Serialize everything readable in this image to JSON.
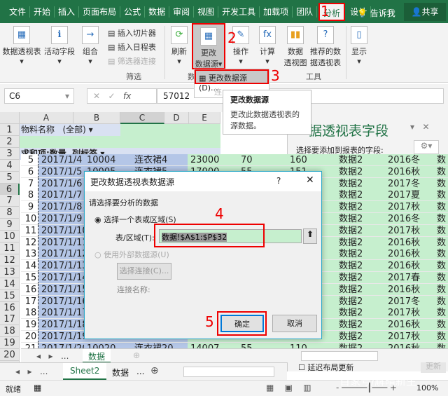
{
  "ribbon_tabs": [
    "文件",
    "开始",
    "插入",
    "页面布局",
    "公式",
    "数据",
    "审阅",
    "视图",
    "开发工具",
    "加载项",
    "团队",
    "分析",
    "设计"
  ],
  "active_tab": "分析",
  "tell_me": "告诉我",
  "share": "共享",
  "ribbon": {
    "pivot_table": "数据透视表",
    "active_field": "活动字段",
    "group": "组合",
    "insert_slicer": "插入切片器",
    "insert_timeline": "插入日程表",
    "filter_connections": "筛选器连接",
    "filter_group": "筛选",
    "refresh": "刷新",
    "change_source_1": "更改",
    "change_source_2": "数据源",
    "actions": "操作",
    "calculate": "计算",
    "pivot_chart_1": "数据",
    "pivot_chart_2": "透视图",
    "recommended_1": "推荐的数",
    "recommended_2": "据透视表",
    "tools_group": "工具",
    "show": "显示",
    "data_group": "数"
  },
  "dropdown": {
    "item": "更改数据源(D)...",
    "partial": "连"
  },
  "tooltip": {
    "title": "更改数据源",
    "body": "更改此数据透视表的源数据。"
  },
  "annotations": [
    "1",
    "2",
    "3",
    "4",
    "5"
  ],
  "formula_bar": {
    "name_box": "C6",
    "value": "57012"
  },
  "outer_sheet": {
    "columns": [
      "A",
      "B",
      "C",
      "D",
      "E"
    ],
    "row_numbers": [
      "1",
      "2",
      "3",
      "4",
      "5",
      "6",
      "7",
      "8",
      "9",
      "10",
      "11",
      "12",
      "13",
      "14",
      "15",
      "16",
      "17",
      "18",
      "19",
      "20",
      "21"
    ],
    "a1": "物料名称",
    "b1": "(全部)",
    "a3": "求和项:数量",
    "b3": "列标签"
  },
  "inner_sheet": {
    "rows": [
      [
        "5",
        "2017/1/4",
        "10004",
        "连衣裙4",
        "23000",
        "70",
        "160",
        "数据2",
        "2016冬",
        "数"
      ],
      [
        "6",
        "2017/1/5",
        "10005",
        "连衣裙5",
        "17000",
        "55",
        "151",
        "数据2",
        "2016秋",
        "数"
      ],
      [
        "7",
        "2017/1/6",
        "",
        "",
        "",
        "",
        "",
        "数据2",
        "2017冬",
        "数"
      ],
      [
        "8",
        "2017/1/7",
        "",
        "",
        "",
        "",
        "",
        "数据2",
        "2017夏",
        "数"
      ],
      [
        "9",
        "2017/1/8",
        "",
        "",
        "",
        "",
        "",
        "数据2",
        "2017秋",
        "数"
      ],
      [
        "10",
        "2017/1/9",
        "",
        "",
        "",
        "",
        "",
        "数据2",
        "2016冬",
        "数"
      ],
      [
        "11",
        "2017/1/10",
        "",
        "",
        "",
        "",
        "",
        "数据2",
        "2017秋",
        "数"
      ],
      [
        "12",
        "2017/1/11",
        "",
        "",
        "",
        "",
        "",
        "数据2",
        "2016秋",
        "数"
      ],
      [
        "13",
        "2017/1/12",
        "",
        "",
        "",
        "",
        "",
        "数据2",
        "2016秋",
        "数"
      ],
      [
        "14",
        "2017/1/13",
        "",
        "",
        "",
        "",
        "",
        "数据2",
        "2016秋",
        "数"
      ],
      [
        "15",
        "2017/1/14",
        "",
        "",
        "",
        "",
        "",
        "数据2",
        "2017春",
        "数"
      ],
      [
        "16",
        "2017/1/15",
        "",
        "",
        "",
        "",
        "",
        "数据2",
        "2016秋",
        "数"
      ],
      [
        "17",
        "2017/1/16",
        "",
        "",
        "",
        "",
        "",
        "数据2",
        "2017冬",
        "数"
      ],
      [
        "18",
        "2017/1/17",
        "",
        "",
        "",
        "",
        "",
        "数据2",
        "2017秋",
        "数"
      ],
      [
        "19",
        "2017/1/18",
        "",
        "",
        "",
        "",
        "",
        "数据2",
        "2016秋",
        "数"
      ],
      [
        "20",
        "2017/1/19",
        "",
        "",
        "",
        "",
        "",
        "数据2",
        "2017秋",
        "数"
      ],
      [
        "21",
        "2017/1/20",
        "10020",
        "连衣裙20",
        "14007",
        "55",
        "110",
        "数据2",
        "2016秋",
        "数"
      ]
    ],
    "sheet_tab": "数据",
    "more": "..."
  },
  "pane": {
    "title": "据透视表字段",
    "prompt": "选择要添加到报表的字段:",
    "defer": "延迟布局更新",
    "update": "更新"
  },
  "sheet_tabs": [
    "Sheet2",
    "数据"
  ],
  "more": "...",
  "status": {
    "ready": "就绪",
    "zoom": "100%"
  },
  "watermark": "百家号/解晴新生",
  "dialog": {
    "title": "更改数据透视表数据源",
    "help": "?",
    "close": "✕",
    "section": "请选择要分析的数据",
    "opt_table": "选择一个表或区域(S)",
    "range_label": "表/区域(T):",
    "range_value": "数据!$A$1:$P$32",
    "opt_external": "使用外部数据源(U)",
    "choose_conn": "选择连接(C)...",
    "conn_name": "连接名称:",
    "ok": "确定",
    "cancel": "取消"
  },
  "colors": {
    "excel_green": "#217346",
    "annotation_red": "#e00000",
    "pivot_green": "#c6efce",
    "pivot_blue": "#b4c6e7"
  }
}
